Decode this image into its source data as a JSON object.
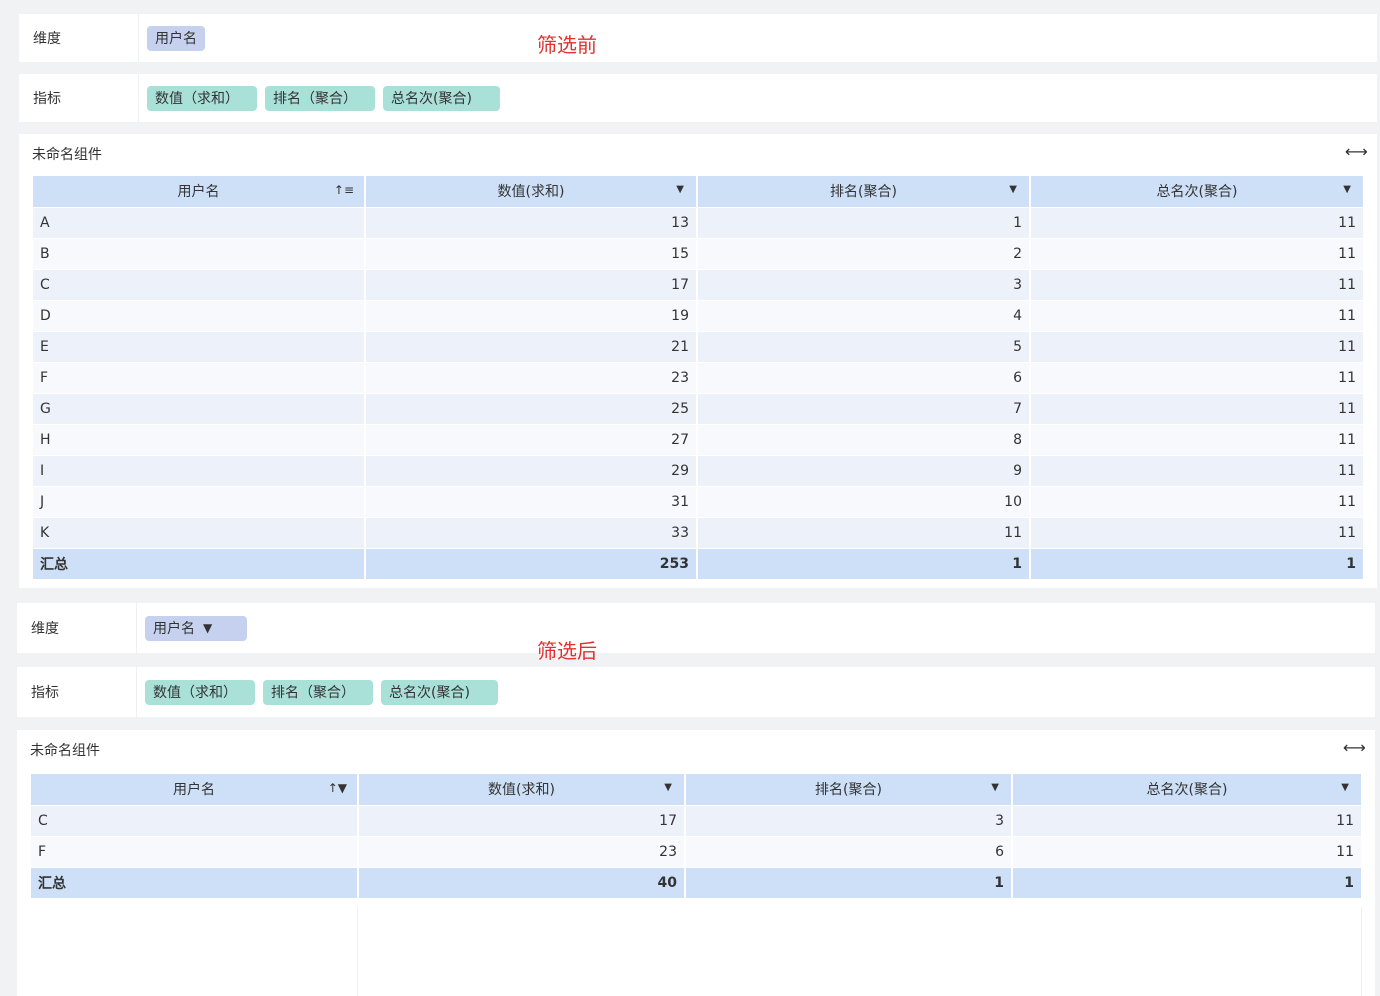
{
  "before": {
    "note": "筛选前",
    "dimension": {
      "label": "维度",
      "chips": [
        "用户名"
      ]
    },
    "metrics": {
      "label": "指标",
      "chips": [
        "数值（求和）",
        "排名（聚合）",
        "总名次(聚合)"
      ]
    },
    "component_title": "未命名组件",
    "table": {
      "headers": [
        "用户名",
        "数值(求和)",
        "排名(聚合)",
        "总名次(聚合)"
      ],
      "rows": [
        [
          "A",
          "13",
          "1",
          "11"
        ],
        [
          "B",
          "15",
          "2",
          "11"
        ],
        [
          "C",
          "17",
          "3",
          "11"
        ],
        [
          "D",
          "19",
          "4",
          "11"
        ],
        [
          "E",
          "21",
          "5",
          "11"
        ],
        [
          "F",
          "23",
          "6",
          "11"
        ],
        [
          "G",
          "25",
          "7",
          "11"
        ],
        [
          "H",
          "27",
          "8",
          "11"
        ],
        [
          "I",
          "29",
          "9",
          "11"
        ],
        [
          "J",
          "31",
          "10",
          "11"
        ],
        [
          "K",
          "33",
          "11",
          "11"
        ]
      ],
      "total": [
        "汇总",
        "253",
        "1",
        "1"
      ]
    }
  },
  "after": {
    "note": "筛选后",
    "dimension": {
      "label": "维度",
      "chips": [
        "用户名"
      ]
    },
    "metrics": {
      "label": "指标",
      "chips": [
        "数值（求和）",
        "排名（聚合）",
        "总名次(聚合)"
      ]
    },
    "component_title": "未命名组件",
    "table": {
      "headers": [
        "用户名",
        "数值(求和)",
        "排名(聚合)",
        "总名次(聚合)"
      ],
      "rows": [
        [
          "C",
          "17",
          "3",
          "11"
        ],
        [
          "F",
          "23",
          "6",
          "11"
        ]
      ],
      "total": [
        "汇总",
        "40",
        "1",
        "1"
      ]
    }
  },
  "colors": {
    "dimension_chip": "#c5d1ee",
    "metric_chip": "#a9e0d8",
    "header": "#cde0f8",
    "note": "#e0312f"
  },
  "icons": {
    "sort": "sort-ascending-icon",
    "filter": "filter-icon",
    "caret": "caret-down-icon",
    "expand": "expand-width-icon"
  }
}
